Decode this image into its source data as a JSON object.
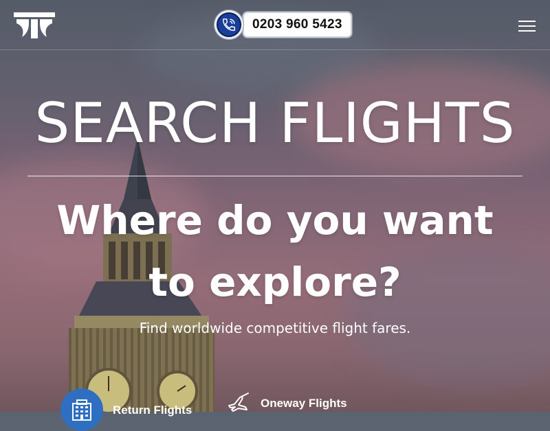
{
  "header": {
    "phone_number": "0203 960 5423",
    "logo_icon": "brand-logo-icon",
    "phone_icon": "phone-call-icon",
    "menu_icon": "hamburger-menu-icon"
  },
  "hero": {
    "title": "SEARCH FLIGHTS",
    "subtitle": "Where do you want to explore?",
    "description": "Find worldwide competitive flight fares."
  },
  "tabs": [
    {
      "label": "Return Flights",
      "icon": "building-icon",
      "active": true
    },
    {
      "label": "Oneway Flights",
      "icon": "airplane-icon",
      "active": false
    }
  ],
  "colors": {
    "accent": "#2f6fc1",
    "phone_badge": "#1a3f9a",
    "text": "#ffffff"
  }
}
